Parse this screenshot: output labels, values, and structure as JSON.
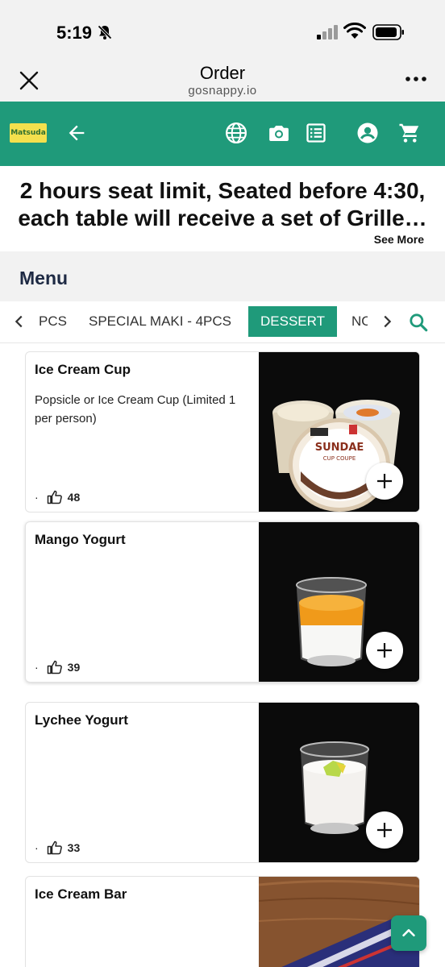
{
  "status_bar": {
    "time": "5:19"
  },
  "browser": {
    "title": "Order",
    "url": "gosnappy.io"
  },
  "app_bar": {
    "logo_text": "Matsuda"
  },
  "announcement": {
    "line1": "2 hours seat limit, Seated before 4:30,",
    "line2": "each table will receive a set of Grille…",
    "see_more": "See More"
  },
  "menu": {
    "heading": "Menu"
  },
  "tabs": {
    "items": [
      "PCS",
      "SPECIAL MAKI - 4PCS",
      "DESSERT",
      "NO"
    ],
    "active": "DESSERT"
  },
  "items": [
    {
      "name": "Ice Cream Cup",
      "description": "Popsicle or Ice Cream Cup (Limited 1 per person)",
      "dot": "·",
      "likes": "48"
    },
    {
      "name": "Mango Yogurt",
      "description": "",
      "dot": "·",
      "likes": "39"
    },
    {
      "name": "Lychee Yogurt",
      "description": "",
      "dot": "·",
      "likes": "33"
    },
    {
      "name": "Ice Cream Bar",
      "description": "",
      "dot": "",
      "likes": ""
    }
  ],
  "image_labels": {
    "sundae": "SUNDAE",
    "cup_coupe": "CUP COUPE"
  },
  "colors": {
    "brand": "#1f9a7a",
    "chrome": "#f2f2f2",
    "heading": "#1e2a44"
  },
  "icons": [
    "bell-slash-icon",
    "signal-icon",
    "wifi-icon",
    "battery-icon",
    "close-icon",
    "more-icon",
    "back-arrow-icon",
    "globe-icon",
    "camera-icon",
    "receipt-icon",
    "account-icon",
    "cart-icon",
    "chevron-left-icon",
    "chevron-right-icon",
    "search-icon",
    "thumbs-up-icon",
    "plus-icon",
    "chevron-up-icon"
  ]
}
